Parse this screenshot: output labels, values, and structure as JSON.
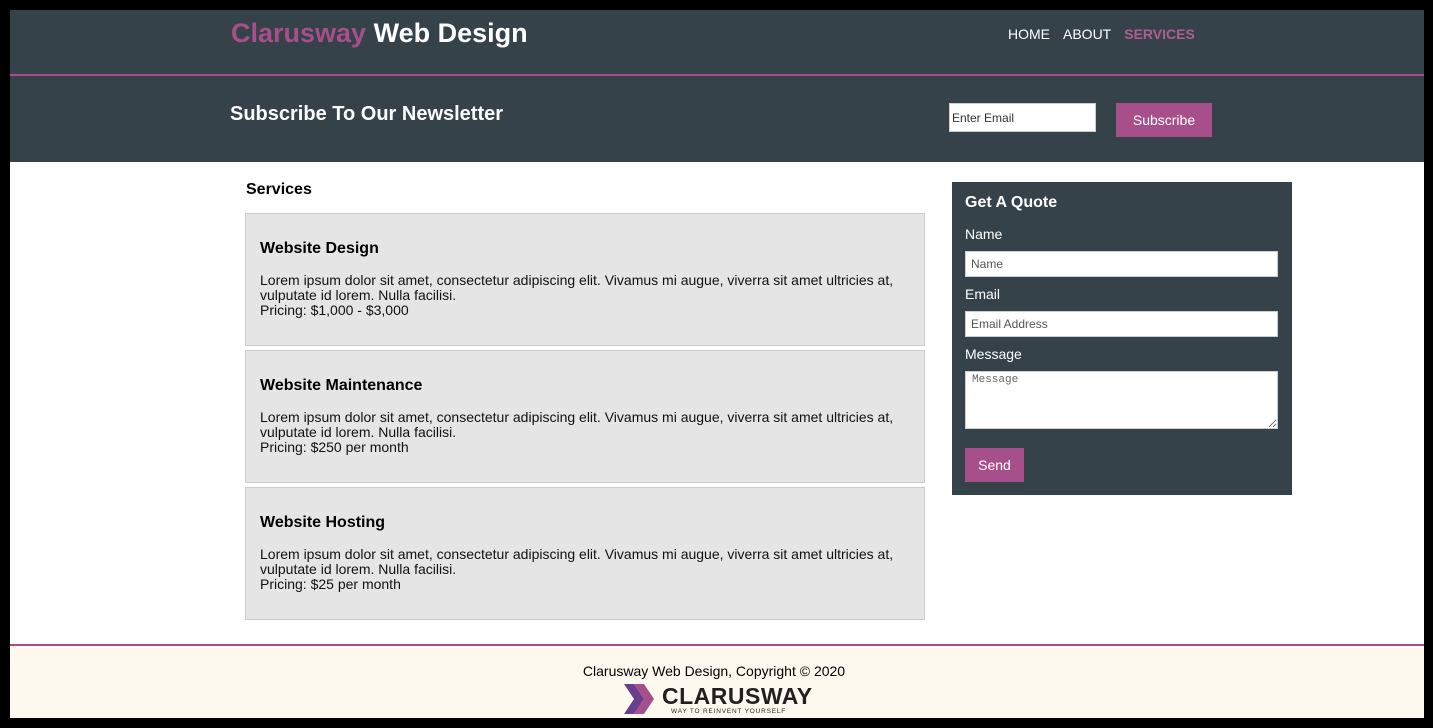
{
  "brand": {
    "highlight": "Clarusway",
    "rest": " Web Design"
  },
  "nav": [
    {
      "label": "HOME",
      "active": false
    },
    {
      "label": "ABOUT",
      "active": false
    },
    {
      "label": "SERVICES",
      "active": true
    }
  ],
  "newsletter": {
    "title": "Subscribe To Our Newsletter",
    "email_placeholder": "Enter Email",
    "button": "Subscribe"
  },
  "services": {
    "title": "Services",
    "items": [
      {
        "title": "Website Design",
        "description": "Lorem ipsum dolor sit amet, consectetur adipiscing elit. Vivamus mi augue, viverra sit amet ultricies at, vulputate id lorem. Nulla facilisi.",
        "pricing": "Pricing: $1,000 - $3,000"
      },
      {
        "title": "Website Maintenance",
        "description": "Lorem ipsum dolor sit amet, consectetur adipiscing elit. Vivamus mi augue, viverra sit amet ultricies at, vulputate id lorem. Nulla facilisi.",
        "pricing": "Pricing: $250 per month"
      },
      {
        "title": "Website Hosting",
        "description": "Lorem ipsum dolor sit amet, consectetur adipiscing elit. Vivamus mi augue, viverra sit amet ultricies at, vulputate id lorem. Nulla facilisi.",
        "pricing": "Pricing: $25 per month"
      }
    ]
  },
  "quote": {
    "title": "Get A Quote",
    "name_label": "Name",
    "name_placeholder": "Name",
    "email_label": "Email",
    "email_placeholder": "Email Address",
    "message_label": "Message",
    "message_placeholder": "Message",
    "button": "Send"
  },
  "footer": {
    "copyright": "Clarusway Web Design, Copyright © 2020",
    "logo_name": "CLARUSWAY",
    "logo_tagline": "WAY TO REINVENT YOURSELF"
  },
  "colors": {
    "accent": "#a64f8b",
    "header_bg": "#35424a",
    "card_bg": "#e5e5e5",
    "footer_bg": "#fdf9ee"
  }
}
